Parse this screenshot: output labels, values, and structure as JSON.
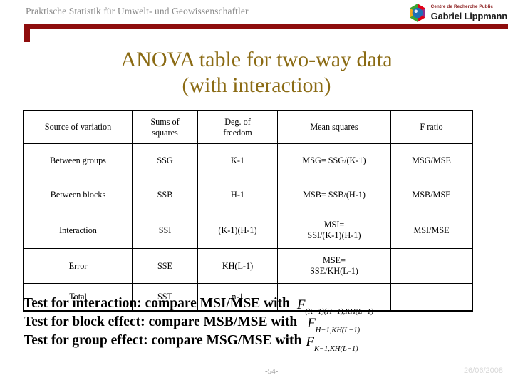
{
  "header": {
    "title": "Praktische Statistik für Umwelt- und Geowissenschaftler",
    "logo": {
      "line1": "Centre de Recherche Public",
      "line2": "Gabriel Lippmann",
      "icon": "hexagon-sphere-logo-icon"
    }
  },
  "slide": {
    "title_line1": "ANOVA table for two-way data",
    "title_line2": "(with interaction)",
    "title_color": "#8B6B14",
    "accent_color": "#8E0D0D"
  },
  "table": {
    "headers": [
      "Source of variation",
      "Sums of squares",
      "Deg. of freedom",
      "Mean squares",
      "F ratio"
    ],
    "header_parts": {
      "h0": "Source of variation",
      "h1a": "Sums of",
      "h1b": "squares",
      "h2a": "Deg. of",
      "h2b": "freedom",
      "h3": "Mean squares",
      "h4": "F ratio"
    },
    "rows": [
      {
        "source": "Between groups",
        "ss": "SSG",
        "df": "K-1",
        "ms": "MSG= SSG/(K-1)",
        "ms_line2": "",
        "f": "MSG/MSE"
      },
      {
        "source": "Between blocks",
        "ss": "SSB",
        "df": "H-1",
        "ms": "MSB= SSB/(H-1)",
        "ms_line2": "",
        "f": "MSB/MSE"
      },
      {
        "source": "Interaction",
        "ss": "SSI",
        "df": "(K-1)(H-1)",
        "ms": "MSI=",
        "ms_line2": "SSI/(K-1)(H-1)",
        "f": "MSI/MSE"
      },
      {
        "source": "Error",
        "ss": "SSE",
        "df": "KH(L-1)",
        "ms": "MSE=",
        "ms_line2": "SSE/KH(L-1)",
        "f": ""
      },
      {
        "source": "Total",
        "ss": "SST",
        "df": "n-1",
        "ms": "",
        "ms_line2": "",
        "f": ""
      }
    ]
  },
  "tests": [
    {
      "text": "Test for interaction: compare MSI/MSE with",
      "f_symbol": "F",
      "f_subscript": "(K−1)(H−1),KH(L−1)"
    },
    {
      "text": "Test for block effect: compare MSB/MSE with",
      "f_symbol": "F",
      "f_subscript": "H−1,KH(L−1)"
    },
    {
      "text": "Test for group effect: compare MSG/MSE with",
      "f_symbol": "F",
      "f_subscript": "K−1,KH(L−1)"
    }
  ],
  "footer": {
    "page_number": "-54-",
    "date": "26/06/2008"
  }
}
